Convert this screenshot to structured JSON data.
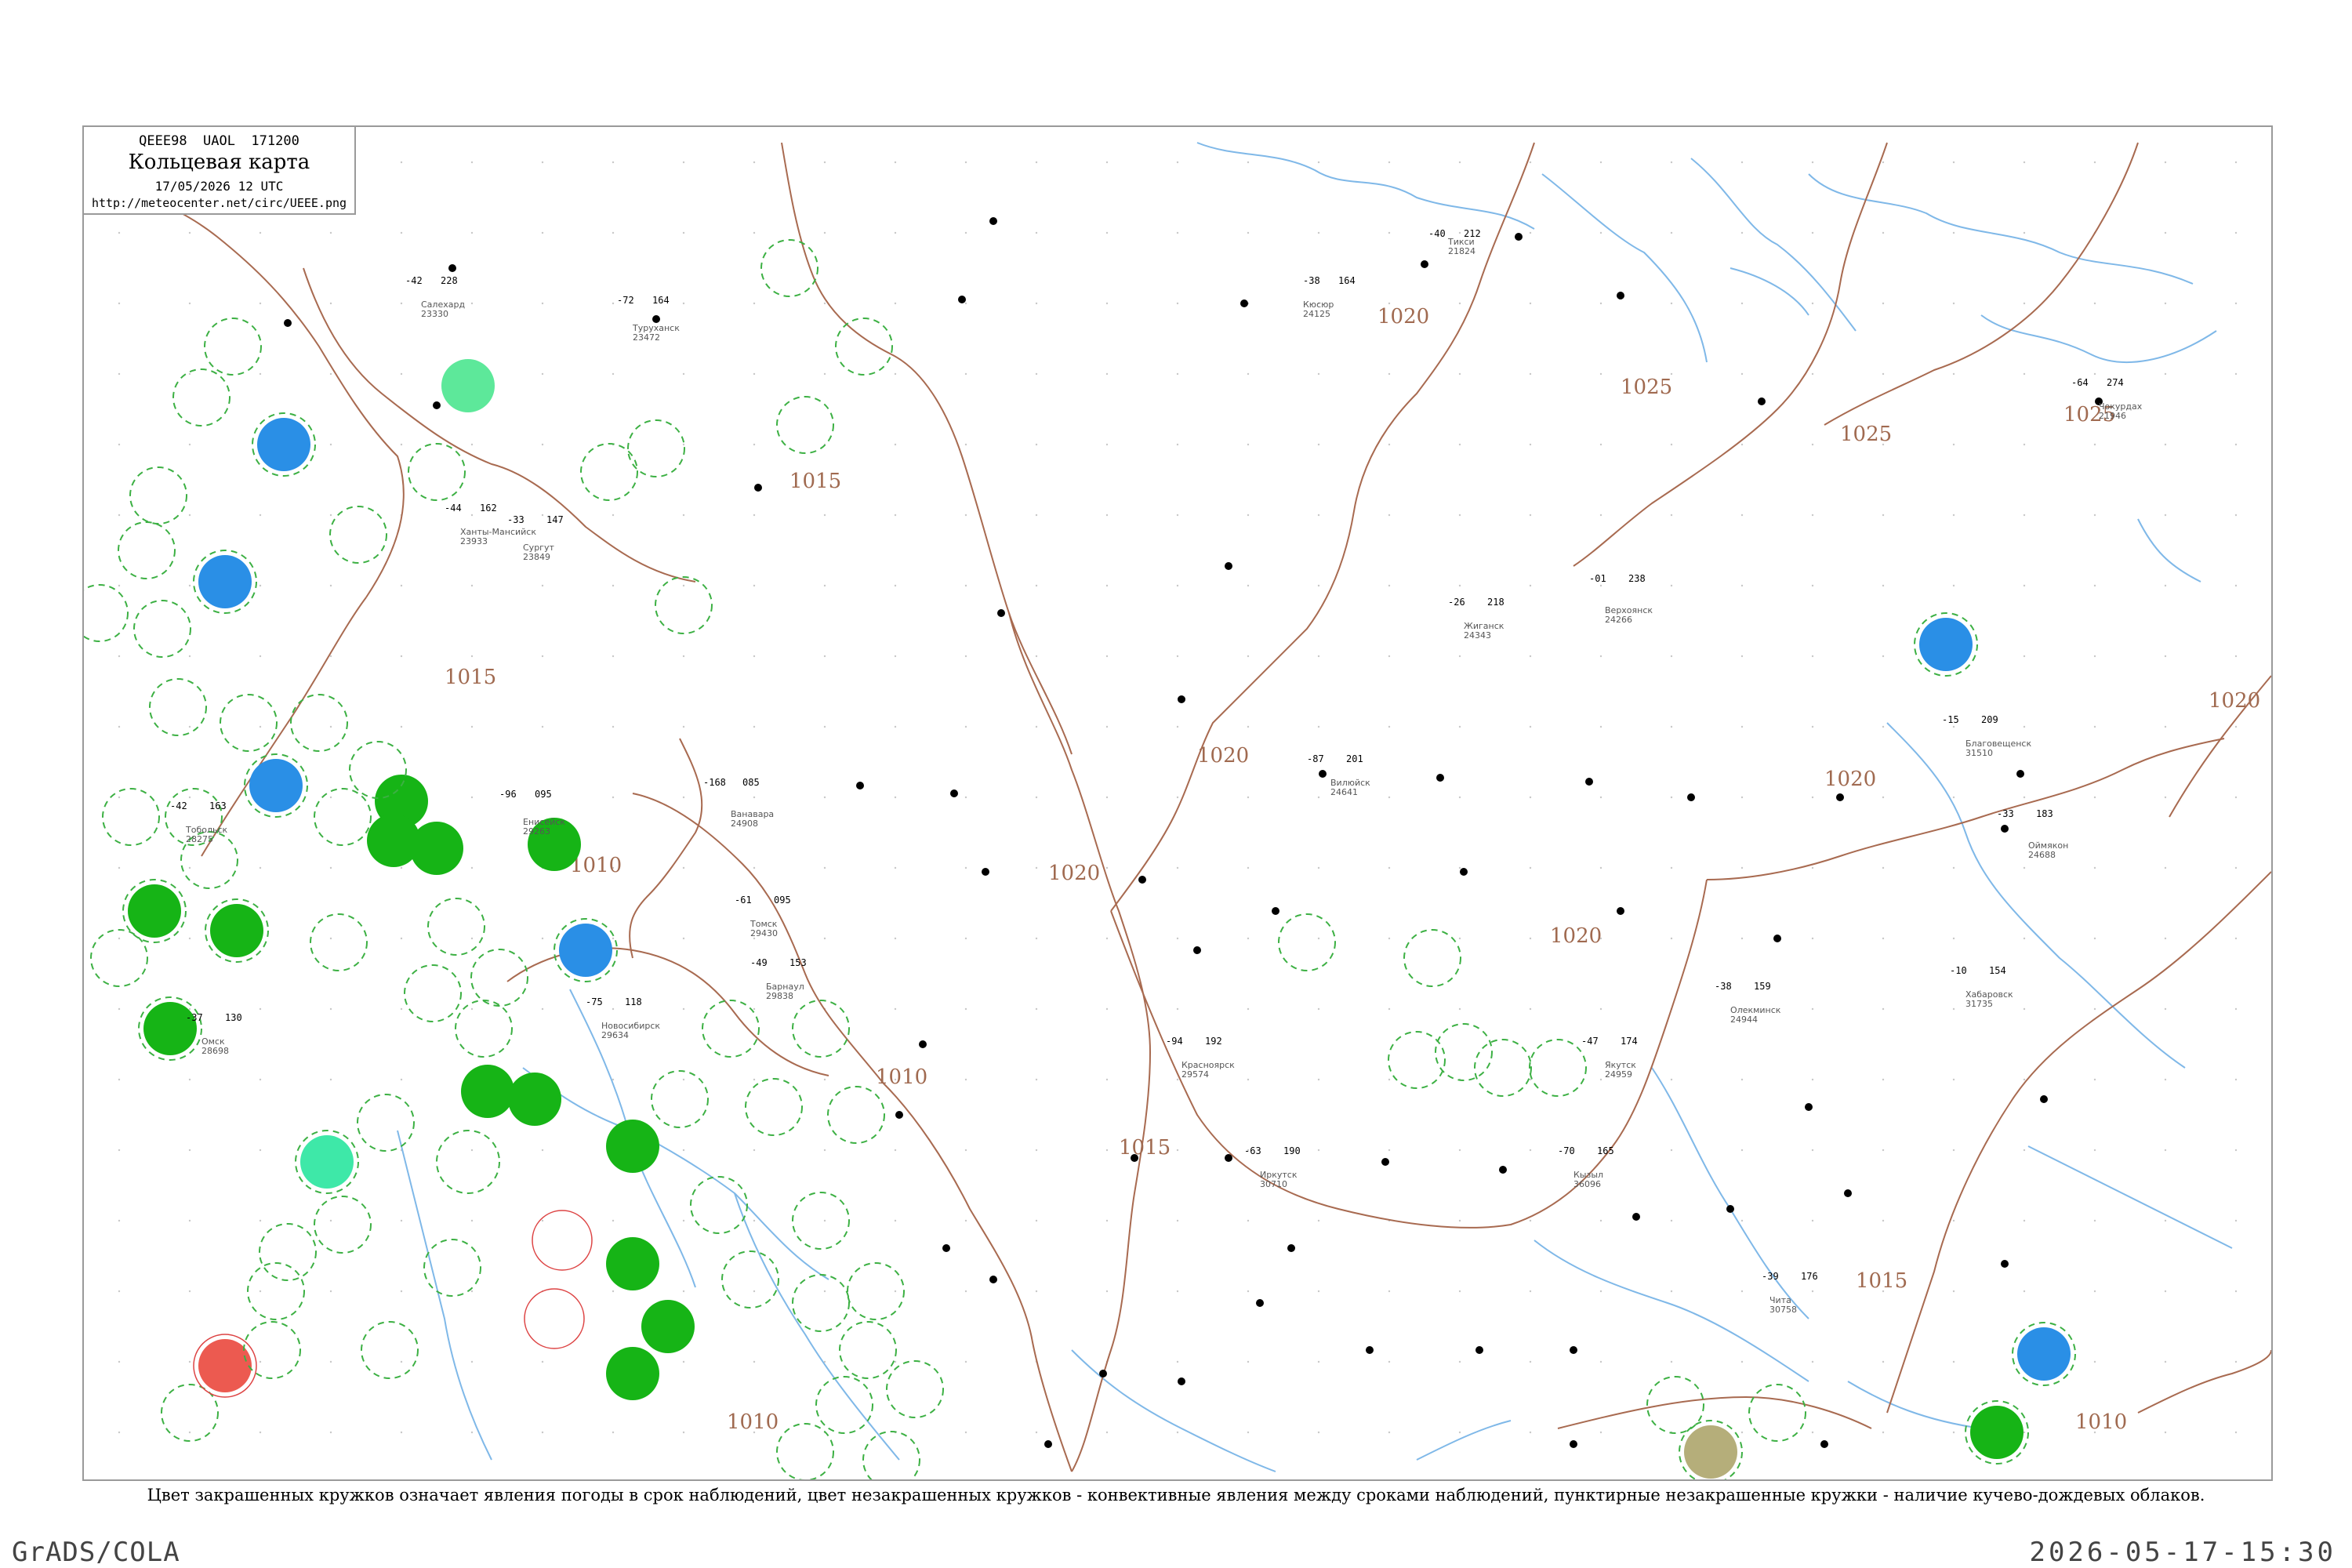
{
  "header": {
    "bulletin_line": "QEEE98  UAOL  171200",
    "title": "Кольцевая карта",
    "date": "17/05/2026 12 UTC",
    "url": "http://meteocenter.net/circ/UEEE.png"
  },
  "caption": "Цвет закрашенных кружков означает явления погоды в срок наблюдений, цвет незакрашенных кружков - конвективные явления между сроками наблюдений, пунктирные незакрашенные кружки - наличие кучево-дождевых облаков.",
  "footer": {
    "left": "GrADS/COLA",
    "right": "2026-05-17-15:30"
  },
  "colors": {
    "frame": "#9a9a9a",
    "rivers": "#7fb8e8",
    "isobars": "#a86a50",
    "dashed_circle": "#3cb043",
    "filled_green": "#16b416",
    "filled_blue": "#2a8fe6",
    "filled_red": "#ec5a50",
    "filled_aqua": "#3ee8a8",
    "filled_olive": "#b5ae7a"
  },
  "isobar_labels": [
    "1015",
    "1015",
    "1015",
    "1010",
    "1010",
    "1010",
    "1015",
    "1020",
    "1020",
    "1020",
    "1020",
    "1025",
    "1025",
    "1025",
    "1020",
    "1020",
    "1015",
    "1010"
  ],
  "stations": [
    {
      "name": "Тикси",
      "id": "21824",
      "t": "-40",
      "p": "212"
    },
    {
      "name": "Кюсюр",
      "id": "24125",
      "t": "-38",
      "p": "164"
    },
    {
      "name": "Чокурдах",
      "id": "21946",
      "t": "-64",
      "p": "274"
    },
    {
      "name": "Оймякон",
      "id": "24688",
      "t": "-33",
      "p": "183"
    },
    {
      "name": "Якутск",
      "id": "24959",
      "t": "-47",
      "p": "174"
    },
    {
      "name": "Верхоянск",
      "id": "24266",
      "t": "-01",
      "p": "238"
    },
    {
      "name": "Жиганск",
      "id": "24343",
      "t": "-26",
      "p": "218"
    },
    {
      "name": "Вилюйск",
      "id": "24641",
      "t": "-87",
      "p": "201"
    },
    {
      "name": "Олекминск",
      "id": "24944",
      "t": "-38",
      "p": "159"
    },
    {
      "name": "Ванавара",
      "id": "24908",
      "t": "-168",
      "p": "085"
    },
    {
      "name": "Туруханск",
      "id": "23472",
      "t": "-72",
      "p": "164"
    },
    {
      "name": "Енисейск",
      "id": "29263",
      "t": "-96",
      "p": "095"
    },
    {
      "name": "Красноярск",
      "id": "29574",
      "t": "-94",
      "p": "192"
    },
    {
      "name": "Иркутск",
      "id": "30710",
      "t": "-63",
      "p": "190"
    },
    {
      "name": "Кызыл",
      "id": "36096",
      "t": "-70",
      "p": "165"
    },
    {
      "name": "Чита",
      "id": "30758",
      "t": "-39",
      "p": "176"
    },
    {
      "name": "Благовещенск",
      "id": "31510",
      "t": "-15",
      "p": "209"
    },
    {
      "name": "Хабаровск",
      "id": "31735",
      "t": "-10",
      "p": "154"
    },
    {
      "name": "Новосибирск",
      "id": "29634",
      "t": "-75",
      "p": "118"
    },
    {
      "name": "Барнаул",
      "id": "29838",
      "t": "-49",
      "p": "153"
    },
    {
      "name": "Томск",
      "id": "29430",
      "t": "-61",
      "p": "095"
    },
    {
      "name": "Омск",
      "id": "28698",
      "t": "-37",
      "p": "130"
    },
    {
      "name": "Тобольск",
      "id": "28275",
      "t": "-42",
      "p": "163"
    },
    {
      "name": "Сургут",
      "id": "23849",
      "t": "-33",
      "p": "147"
    },
    {
      "name": "Салехард",
      "id": "23330",
      "t": "-42",
      "p": "228"
    },
    {
      "name": "Ханты-Мансийск",
      "id": "23933",
      "t": "-44",
      "p": "162"
    }
  ]
}
